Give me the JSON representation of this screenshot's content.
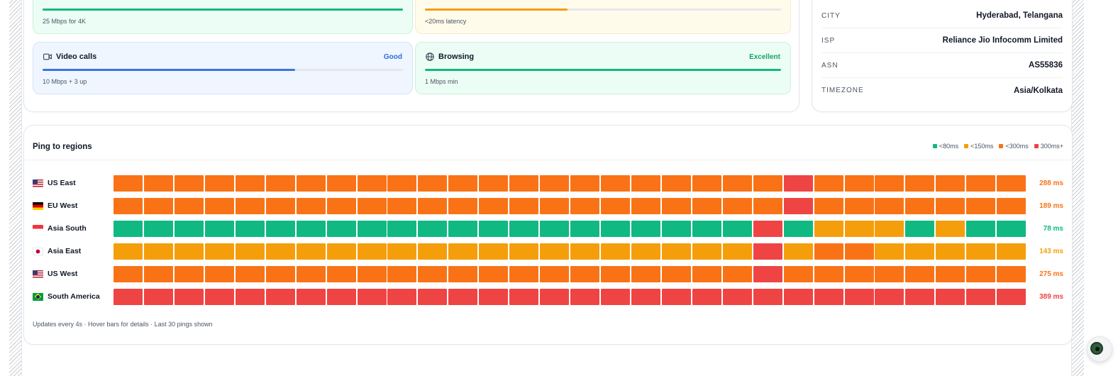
{
  "tips": {
    "top_left_note": "25 Mbps for 4K",
    "top_left_fill": 1.0,
    "top_left_color": "#10b981",
    "top_right_note": "<20ms latency",
    "top_right_fill": 0.4,
    "top_right_color": "#f59e0b",
    "video": {
      "title": "Video calls",
      "status": "Good",
      "note": "10 Mbps + 3 up",
      "fill": 0.7,
      "color": "#3b74e3",
      "status_color": "#2f6bdc",
      "icon": "video-icon"
    },
    "browsing": {
      "title": "Browsing",
      "status": "Excellent",
      "note": "1 Mbps min",
      "fill": 1.0,
      "color": "#10b981",
      "status_color": "#16a36a",
      "icon": "globe-icon"
    }
  },
  "info": {
    "rows": [
      {
        "key": "CITY",
        "value": "Hyderabad, Telangana"
      },
      {
        "key": "ISP",
        "value": "Reliance Jio Infocomm Limited"
      },
      {
        "key": "ASN",
        "value": "AS55836"
      },
      {
        "key": "TIMEZONE",
        "value": "Asia/Kolkata"
      }
    ]
  },
  "ping": {
    "title": "Ping to regions",
    "legend": [
      {
        "label": "<80ms",
        "color": "#10b981"
      },
      {
        "label": "<150ms",
        "color": "#f59e0b"
      },
      {
        "label": "<300ms",
        "color": "#f97316"
      },
      {
        "label": "300ms+",
        "color": "#ef4444"
      }
    ],
    "palette": {
      "g": "#10b981",
      "y": "#f59e0b",
      "o": "#f97316",
      "r": "#ef4444"
    },
    "regions": [
      {
        "name": "US East",
        "flag": "us-flag",
        "ms": "288 ms",
        "ms_color": "#f97316",
        "pings": "ooooooooooooooooooooooroooooooo"
      },
      {
        "name": "EU West",
        "flag": "de-flag",
        "ms": "189 ms",
        "ms_color": "#f97316",
        "pings": "ooooooooooooooooooooooroooooooo"
      },
      {
        "name": "Asia South",
        "flag": "sg-flag",
        "ms": "78 ms",
        "ms_color": "#10b981",
        "pings": "gggggggggggggggggggggrgyyygygg"
      },
      {
        "name": "Asia East",
        "flag": "jp-flag",
        "ms": "143 ms",
        "ms_color": "#f59e0b",
        "pings": "yyyyyyyyyyyyyyyyyyyyyryooyyyyy"
      },
      {
        "name": "US West",
        "flag": "us-flag",
        "ms": "275 ms",
        "ms_color": "#f97316",
        "pings": "ooooooooooooooooooooorooooooooo"
      },
      {
        "name": "South America",
        "flag": "br-flag",
        "ms": "389 ms",
        "ms_color": "#ef4444",
        "pings": "rrrrrrrrrrrrrrrrrrrrrrrrrrrrrr"
      }
    ],
    "footer": "Updates every 4s · Hover bars for details · Last 30 pings shown"
  }
}
